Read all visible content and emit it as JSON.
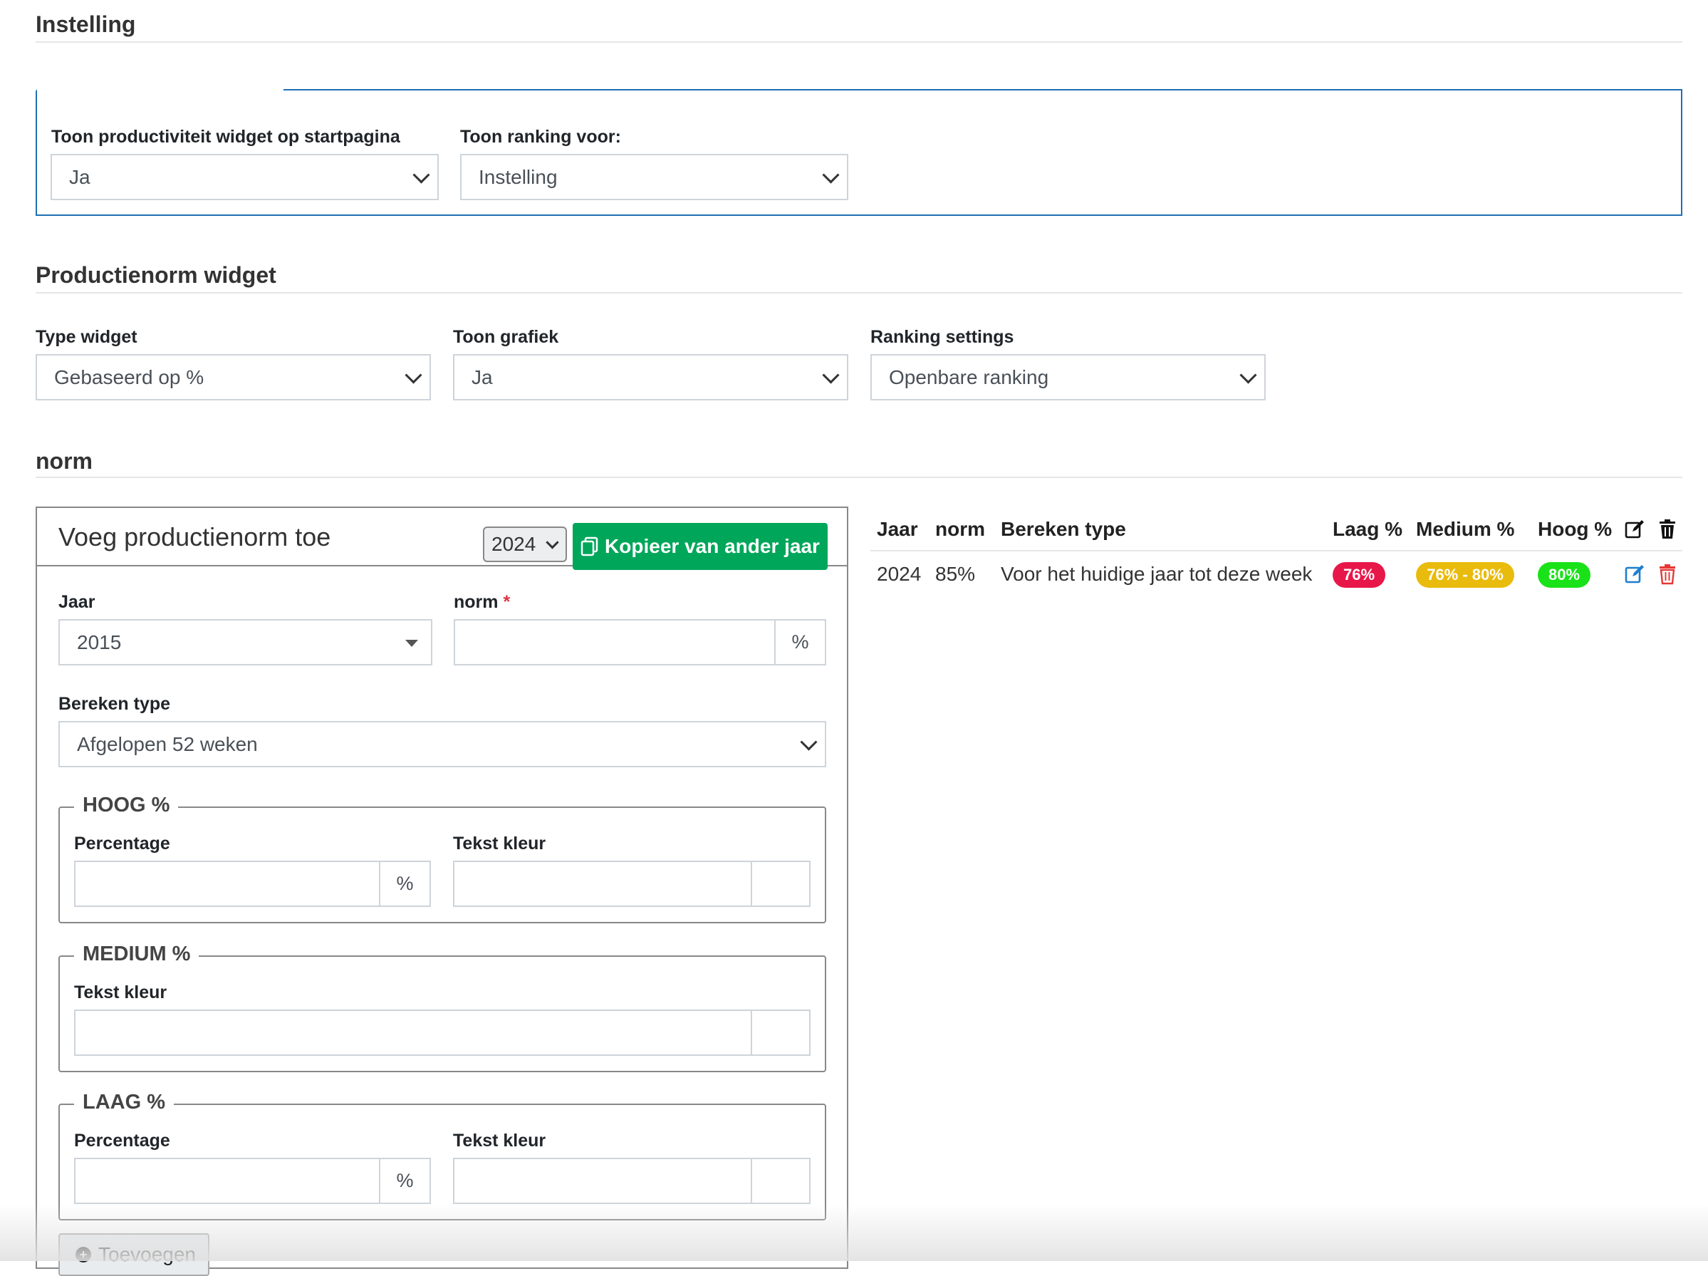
{
  "sections": {
    "instelling": "Instelling",
    "productienorm_widget": "Productienorm widget",
    "norm": "norm"
  },
  "instelling": {
    "show_widget_label": "Toon productiviteit widget op startpagina",
    "show_widget_value": "Ja",
    "ranking_for_label": "Toon ranking voor:",
    "ranking_for_value": "Instelling"
  },
  "widget": {
    "type_label": "Type widget",
    "type_value": "Gebaseerd op %",
    "chart_label": "Toon grafiek",
    "chart_value": "Ja",
    "ranking_label": "Ranking settings",
    "ranking_value": "Openbare ranking"
  },
  "form": {
    "title": "Voeg productienorm toe",
    "year_select": "2024",
    "copy_button": "Kopieer van ander jaar",
    "jaar_label": "Jaar",
    "jaar_value": "2015",
    "norm_label": "norm",
    "required_mark": "*",
    "percent_sign": "%",
    "bereken_label": "Bereken type",
    "bereken_value": "Afgelopen 52 weken",
    "hoog_legend": "HOOG %",
    "medium_legend": "MEDIUM %",
    "laag_legend": "LAAG %",
    "percentage_label": "Percentage",
    "tekst_kleur_label": "Tekst kleur",
    "add_button": "Toevoegen"
  },
  "table": {
    "headers": {
      "jaar": "Jaar",
      "norm": "norm",
      "bereken_type": "Bereken type",
      "laag": "Laag %",
      "medium": "Medium %",
      "hoog": "Hoog %"
    },
    "rows": [
      {
        "jaar": "2024",
        "norm": "85%",
        "bereken_type": "Voor het huidige jaar tot deze week",
        "laag": "76%",
        "medium": "76% - 80%",
        "hoog": "80%"
      }
    ]
  },
  "colors": {
    "accent_blue": "#1f6fb2",
    "button_green": "#00a65a",
    "badge_laag": "#e8174a",
    "badge_medium": "#e9bb0c",
    "badge_hoog": "#19e219",
    "edit_icon": "#1b7fd0",
    "delete_icon": "#e53935"
  },
  "icons": {
    "copy": "copy-icon",
    "edit": "edit-icon",
    "delete": "trash-icon",
    "add": "plus-circle-icon",
    "dropdown": "chevron-down-icon"
  }
}
